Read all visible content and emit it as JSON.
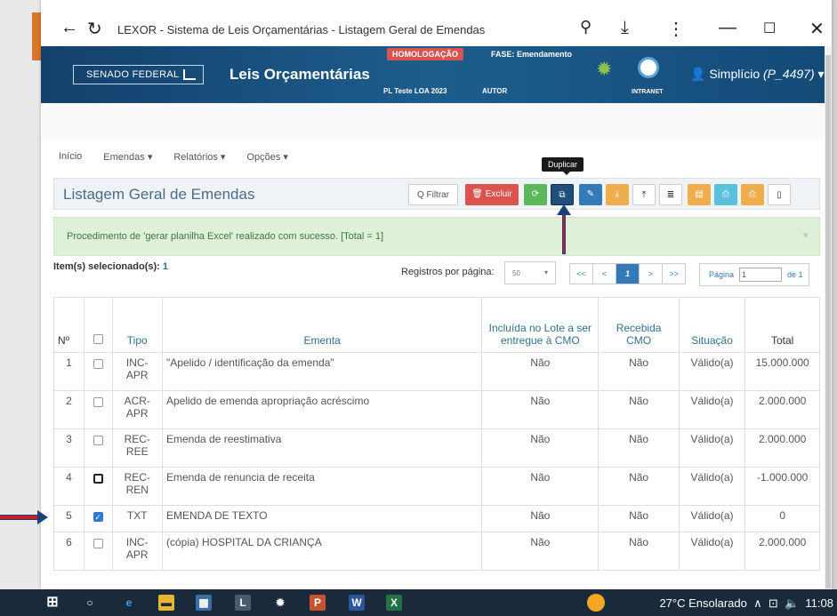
{
  "browser": {
    "title": "LEXOR - Sistema de Leis Orçamentárias - Listagem Geral de Emendas"
  },
  "header": {
    "brand": "SENADO FEDERAL",
    "app_name": "Leis Orçamentárias",
    "env_badge": "HOMOLOGAÇÃO",
    "phase": "FASE: Emendamento",
    "pl": "PL Teste LOA 2023",
    "role": "AUTOR",
    "intranet": "INTRANET",
    "user_name": "Simplício",
    "user_handle": "(P_4497)"
  },
  "nav": {
    "items": [
      "Início",
      "Emendas ▾",
      "Relatórios ▾",
      "Opções ▾"
    ]
  },
  "panel": {
    "title": "Listagem Geral de Emendas",
    "filter_label": "Q Filtrar",
    "delete_label": "🗑 Excluir",
    "tooltip": "Duplicar"
  },
  "alert": {
    "message": "Procedimento de 'gerar planilha Excel' realizado com sucesso. [Total = 1]",
    "close": "×"
  },
  "selection": {
    "label": "Item(s) selecionado(s):",
    "count": "1"
  },
  "paging": {
    "per_page_label": "Registros por página:",
    "per_page_value": "50",
    "buttons": [
      "<<",
      "<",
      "1",
      ">",
      ">>"
    ],
    "page_label": "Página",
    "page_value": "1",
    "page_of": "de 1"
  },
  "table": {
    "headers": {
      "num": "Nº",
      "tipo": "Tipo",
      "ementa": "Ementa",
      "lote": "Incluída no Lote a ser entregue à CMO",
      "recebida": "Recebida CMO",
      "situacao": "Situação",
      "total": "Total"
    },
    "rows": [
      {
        "num": "1",
        "tipo": "INC-APR",
        "ementa": "\"Apelido / identificação da emenda\"",
        "lote": "Não",
        "recebida": "Não",
        "situacao": "Válido(a)",
        "total": "15.000.000"
      },
      {
        "num": "2",
        "tipo": "ACR-APR",
        "ementa": "Apelido de emenda apropriação acréscimo",
        "lote": "Não",
        "recebida": "Não",
        "situacao": "Válido(a)",
        "total": "2.000.000"
      },
      {
        "num": "3",
        "tipo": "REC-REE",
        "ementa": "Emenda de reestimativa",
        "lote": "Não",
        "recebida": "Não",
        "situacao": "Válido(a)",
        "total": "2.000.000"
      },
      {
        "num": "4",
        "tipo": "REC-REN",
        "ementa": "Emenda de renuncia de receita",
        "lote": "Não",
        "recebida": "Não",
        "situacao": "Válido(a)",
        "total": "-1.000.000"
      },
      {
        "num": "5",
        "tipo": "TXT",
        "ementa": "EMENDA DE TEXTO",
        "lote": "Não",
        "recebida": "Não",
        "situacao": "Válido(a)",
        "total": "0"
      },
      {
        "num": "6",
        "tipo": "INC-APR",
        "ementa": "(cópia) HOSPITAL DA CRIANÇA",
        "lote": "Não",
        "recebida": "Não",
        "situacao": "Válido(a)",
        "total": "2.000.000"
      }
    ]
  },
  "taskbar": {
    "weather": "27°C  Ensolarado",
    "time": "11:08"
  },
  "colors": {
    "header_blue": "#1d5d8c",
    "danger": "#d9534f",
    "success": "#5cb85c",
    "primary": "#337ab7",
    "warning": "#f0ad4e"
  }
}
